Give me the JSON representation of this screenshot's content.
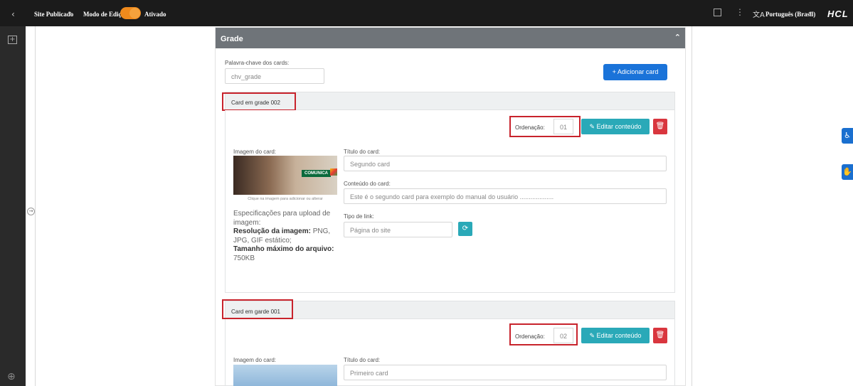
{
  "topbar": {
    "site_status": "Site Publicado",
    "mode_label": "Modo de Edição:",
    "mode_state": "Ativado",
    "language": "Português (Brasil)",
    "brand": "HCL"
  },
  "panel": {
    "title": "Grade",
    "keyword_label": "Palavra-chave dos cards:",
    "keyword_value": "chv_grade",
    "add_card_label": "+ Adicionar card"
  },
  "cards": [
    {
      "header": "Card em grade 002",
      "order_label": "Ordenação:",
      "order_value": "01",
      "edit_label": "Editar conteúdo",
      "image_label": "Imagem do card:",
      "image_badge": "COMUNICA",
      "image_caption": "Clique na imagem para adicionar ou alterar",
      "title_label": "Título do card:",
      "title_value": "Segundo card",
      "content_label": "Conteúdo do card:",
      "content_value": "Este é o segundo card para exemplo do manual do usuário ...................",
      "link_label": "Tipo de link:",
      "link_value": "Página do site",
      "specs_title": "Especificações para upload de imagem:",
      "specs_res_label": "Resolução da imagem:",
      "specs_res_value": "PNG, JPG, GIF estático;",
      "specs_size_label": "Tamanho máximo do arquivo:",
      "specs_size_value": "750KB"
    },
    {
      "header": "Card em garde 001",
      "order_label": "Ordenação:",
      "order_value": "02",
      "edit_label": "Editar conteúdo",
      "image_label": "Imagem do card:",
      "title_label": "Título do card:",
      "title_value": "Primeiro card"
    }
  ],
  "colors": {
    "accent_blue": "#1a73d9",
    "teal": "#2aa9b8",
    "danger": "#d9363e",
    "highlight_red": "#c8232c",
    "toggle_orange": "#f08a1c"
  }
}
